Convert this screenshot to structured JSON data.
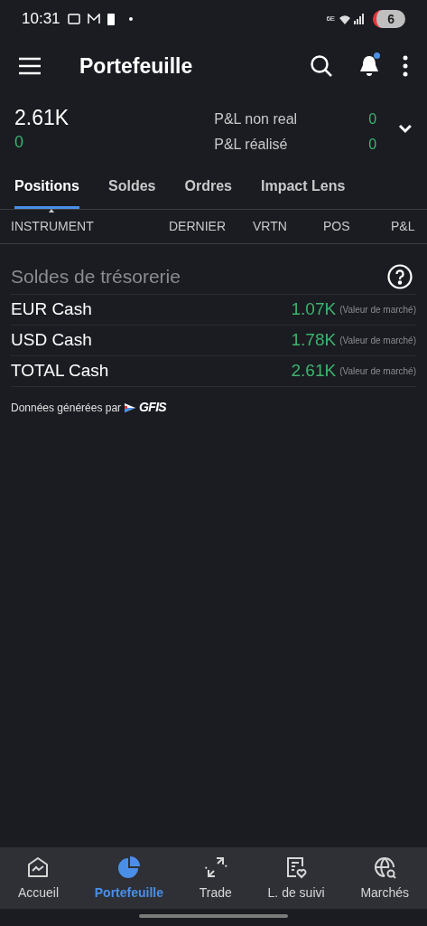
{
  "status_bar": {
    "time": "10:31",
    "network": "6E",
    "battery": "6"
  },
  "header": {
    "title": "Portefeuille",
    "notification_dot": true
  },
  "summary": {
    "value": "2.61K",
    "change": "0",
    "pnl": [
      {
        "label": "P&L non real",
        "value": "0"
      },
      {
        "label": "P&L réalisé",
        "value": "0"
      }
    ]
  },
  "tabs": [
    {
      "label": "Positions",
      "selected": true
    },
    {
      "label": "Soldes",
      "selected": false
    },
    {
      "label": "Ordres",
      "selected": false
    },
    {
      "label": "Impact Lens",
      "selected": false
    }
  ],
  "table": {
    "columns": [
      {
        "label": "INSTRUMENT",
        "sorted": true
      },
      {
        "label": "DERNIER",
        "sorted": false
      },
      {
        "label": "VRTN",
        "sorted": false
      },
      {
        "label": "POS",
        "sorted": false
      },
      {
        "label": "P&L",
        "sorted": false
      }
    ]
  },
  "cash_balances": {
    "title": "Soldes de trésorerie",
    "rows": [
      {
        "name": "EUR Cash",
        "value": "1.07K",
        "note": "(Valeur de marché)"
      },
      {
        "name": "USD Cash",
        "value": "1.78K",
        "note": "(Valeur de marché)"
      },
      {
        "name": "TOTAL Cash",
        "value": "2.61K",
        "note": "(Valeur de marché)"
      }
    ],
    "footer": "Données générées par",
    "provider": "GFIS"
  },
  "bottom_nav": [
    {
      "label": "Accueil",
      "selected": false
    },
    {
      "label": "Portefeuille",
      "selected": true
    },
    {
      "label": "Trade",
      "selected": false
    },
    {
      "label": "L. de suivi",
      "selected": false
    },
    {
      "label": "Marchés",
      "selected": false
    }
  ]
}
